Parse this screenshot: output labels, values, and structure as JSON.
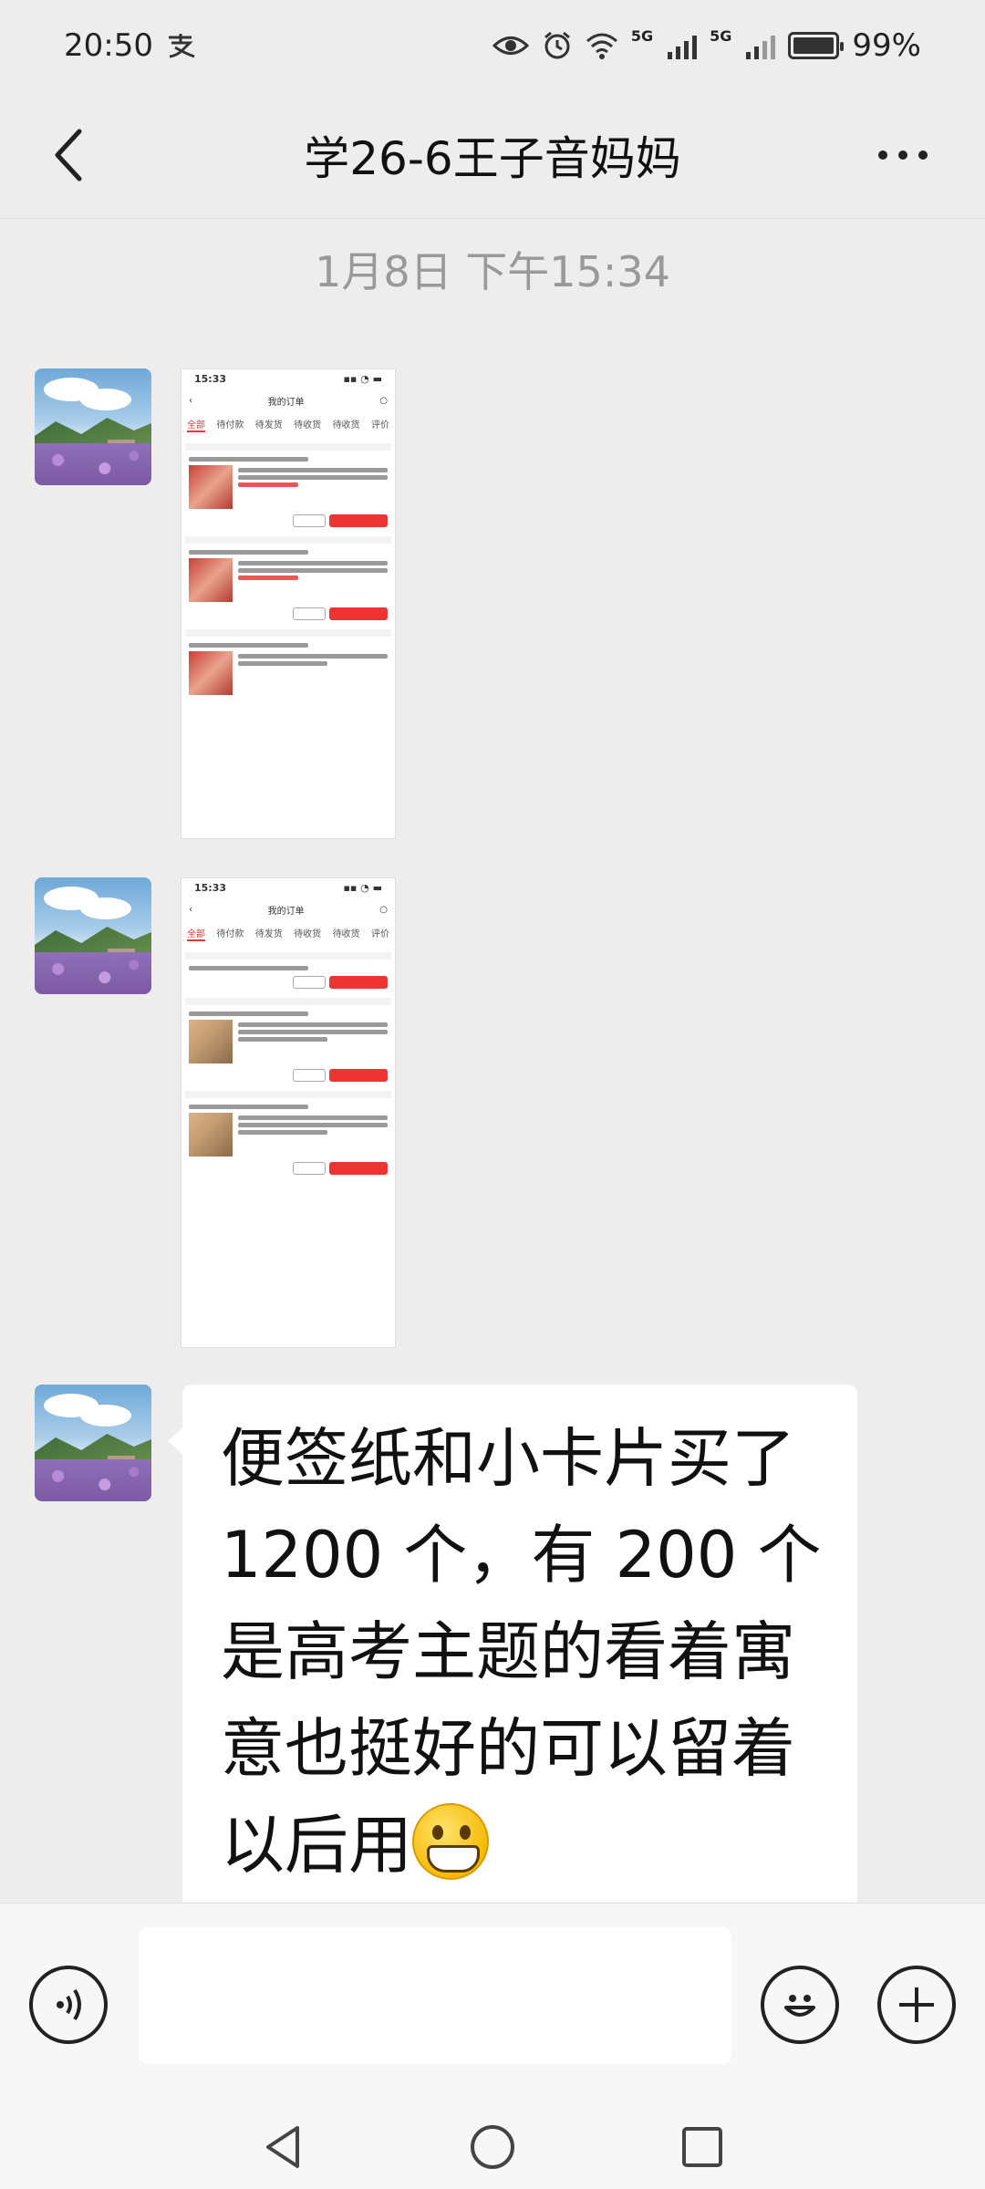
{
  "status_bar": {
    "time": "20:50",
    "pay_icon": "alipay-icon",
    "network_1": "5G",
    "network_2": "5G",
    "battery": "99%",
    "battery_level": 0.99
  },
  "header": {
    "title": "学26-6王子音妈妈"
  },
  "timestamp": "1月8日 下午15:34",
  "thumbnail": {
    "time": "15:33",
    "page_title": "我的订单",
    "tabs": [
      "全部",
      "待付款",
      "待发货",
      "待收货",
      "待收货",
      "评价"
    ]
  },
  "message": {
    "lines": [
      "便签纸和小卡片买了",
      "1200 个，有 200 个",
      "是高考主题的看着寓",
      "意也挺好的可以留着",
      "以后用"
    ],
    "emoji": "grinning-face-emoji"
  },
  "input": {
    "placeholder": ""
  },
  "colors": {
    "background": "#ededed",
    "bubble": "#ffffff",
    "accent_red": "#e33333"
  }
}
